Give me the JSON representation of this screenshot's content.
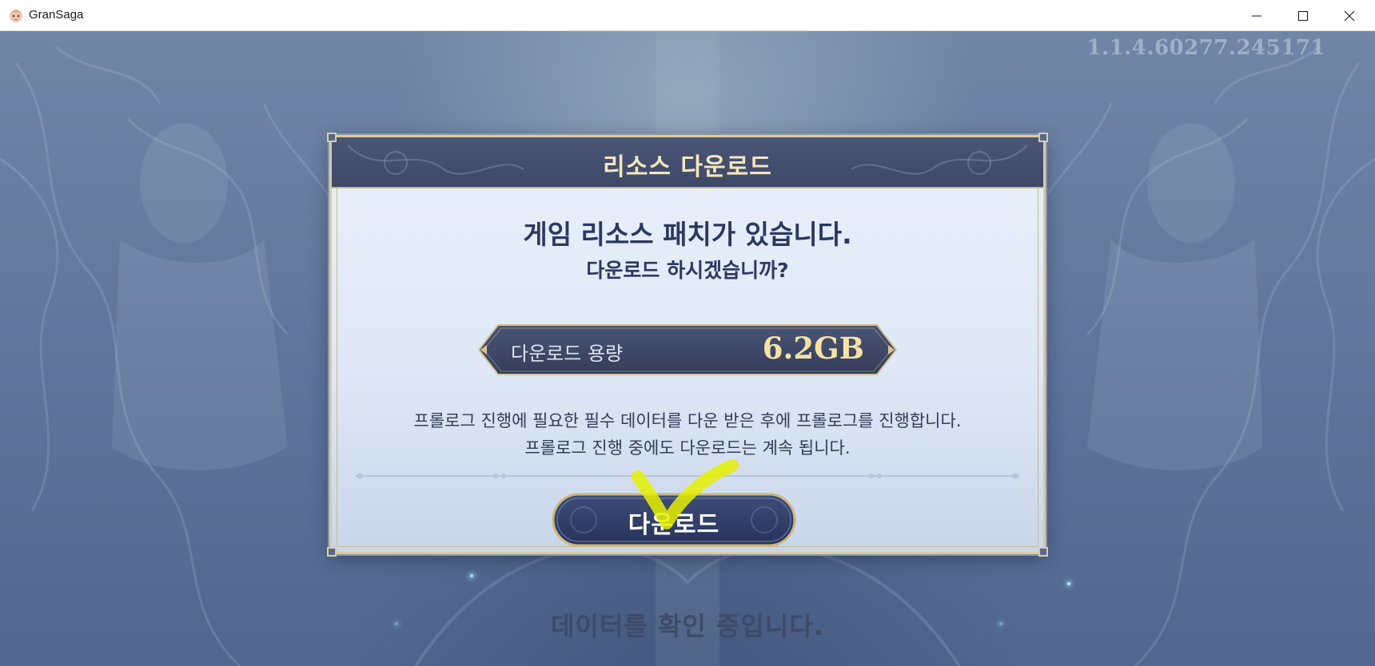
{
  "window": {
    "title": "GranSaga",
    "icon": "gransaga-app-icon",
    "controls": {
      "minimize_icon": "minimize-icon",
      "maximize_icon": "maximize-icon",
      "close_icon": "close-icon"
    }
  },
  "game": {
    "version": "1.1.4.60277.245171",
    "status_text": "데이터를 확인 중입니다."
  },
  "dialog": {
    "title": "리소스 다운로드",
    "headline": "게임 리소스 패치가 있습니다.",
    "subheadline": "다운로드 하시겠습니까?",
    "download_size": {
      "label": "다운로드 용량",
      "value": "6.2GB"
    },
    "info_lines": [
      "프롤로그 진행에 필요한 필수 데이터를 다운 받은 후에 프롤로그를 진행합니다.",
      "프롤로그 진행 중에도 다운로드는 계속 됩니다."
    ],
    "download_button_label": "다운로드"
  },
  "colors": {
    "header_bg": "#434e6f",
    "title_gold": "#f4e6bd",
    "dialog_bg": "#e3ebf8",
    "headline_text": "#2b3860",
    "annotation_check": "#e5ee00"
  }
}
